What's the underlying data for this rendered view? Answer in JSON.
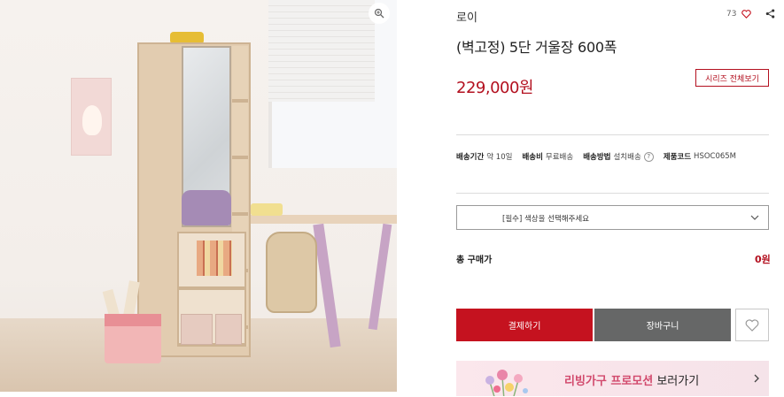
{
  "image": {
    "zoom_icon": "zoom-in-icon"
  },
  "product": {
    "brand": "로이",
    "like_count": "73",
    "title": "(벽고정) 5단 거울장 600폭",
    "price": "229,000원",
    "series_button": "시리즈 전체보기"
  },
  "shipping_info": [
    {
      "key": "배송기간",
      "value": "약 10일",
      "help": false
    },
    {
      "key": "배송비",
      "value": "무료배송",
      "help": false
    },
    {
      "key": "배송방법",
      "value": "설치배송",
      "help": true
    },
    {
      "key": "제품코드",
      "value": "HSOC065M",
      "help": false
    }
  ],
  "option_select": {
    "value": "[필수] 색상을 선택해주세요"
  },
  "total": {
    "label": "총 구매가",
    "value": "0원"
  },
  "buttons": {
    "buy": "결제하기",
    "cart": "장바구니"
  },
  "promo": {
    "highlight": "리빙가구 프로모션",
    "rest": " 보러가기"
  },
  "colors": {
    "accent": "#c5121f",
    "price": "#b3101f",
    "cart": "#666767",
    "promo_bg": "#fbe7ec"
  }
}
